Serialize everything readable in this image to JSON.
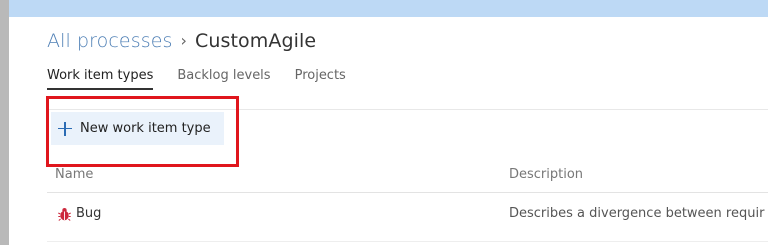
{
  "breadcrumb": {
    "parent": "All processes",
    "separator": "›",
    "current": "CustomAgile"
  },
  "tabs": [
    {
      "label": "Work item types",
      "active": true
    },
    {
      "label": "Backlog levels",
      "active": false
    },
    {
      "label": "Projects",
      "active": false
    }
  ],
  "toolbar": {
    "new_button_label": "New work item type",
    "new_button_icon": "plus-icon"
  },
  "table": {
    "columns": [
      "Name",
      "Description"
    ],
    "rows": [
      {
        "name": "Bug",
        "icon": "bug-icon",
        "icon_color": "#cc293d",
        "description": "Describes a divergence between requir"
      }
    ]
  },
  "colors": {
    "accent": "#2b6cb4",
    "highlight_border": "#e0161d",
    "banner": "#bdd9f5"
  }
}
